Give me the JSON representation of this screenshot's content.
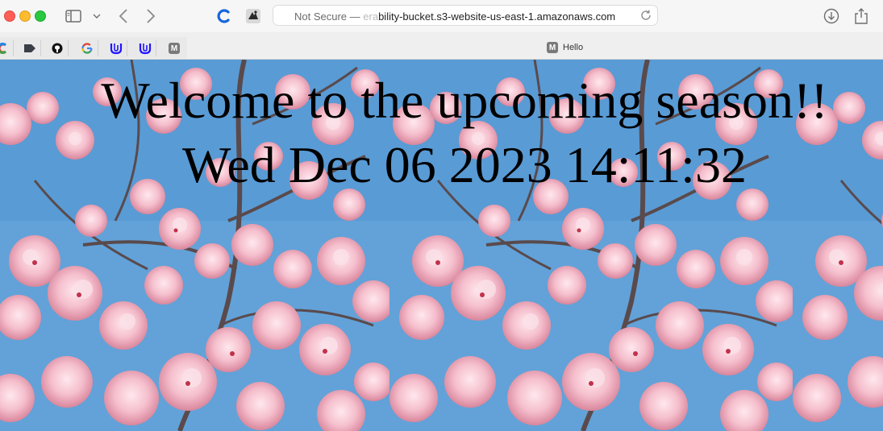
{
  "browser": {
    "address": {
      "security_label": "Not Secure —",
      "faded_prefix": "era",
      "url": "bility-bucket.s3-website-us-east-1.amazonaws.com"
    },
    "favorites": [
      {
        "icon": "colorful-c-icon"
      },
      {
        "icon": "arrow-bookmark-icon"
      },
      {
        "icon": "github-icon"
      },
      {
        "icon": "google-icon"
      },
      {
        "icon": "udacity-icon"
      },
      {
        "icon": "udacity-icon"
      },
      {
        "icon": "m-letter-icon",
        "letter": "M"
      }
    ],
    "tab": {
      "icon_letter": "M",
      "title": "Hello"
    }
  },
  "page": {
    "headline": "Welcome to the upcoming season!!",
    "datetime": "Wed Dec 06 2023 14:11:32",
    "background": "cherry-blossom-tiles"
  },
  "colors": {
    "sky": "#5c9bd4",
    "blossom": "#f4c2cf",
    "branch": "#5a4a4c"
  }
}
